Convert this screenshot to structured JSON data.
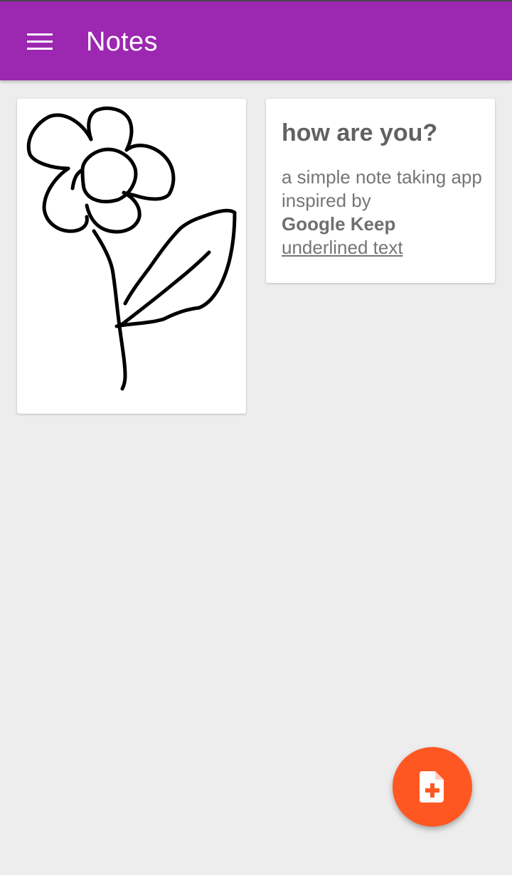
{
  "app_bar": {
    "title": "Notes",
    "menu_icon": "hamburger-menu-icon",
    "color": "#9c27b0"
  },
  "notes": [
    {
      "type": "drawing",
      "drawing_subject": "flower sketch"
    },
    {
      "type": "text",
      "title": "how are you?",
      "body_plain": "a simple note taking app inspired by",
      "body_bold": "Google Keep",
      "body_underlined": "underlined text"
    }
  ],
  "fab": {
    "icon": "add-note-icon",
    "color": "#ff5722"
  }
}
